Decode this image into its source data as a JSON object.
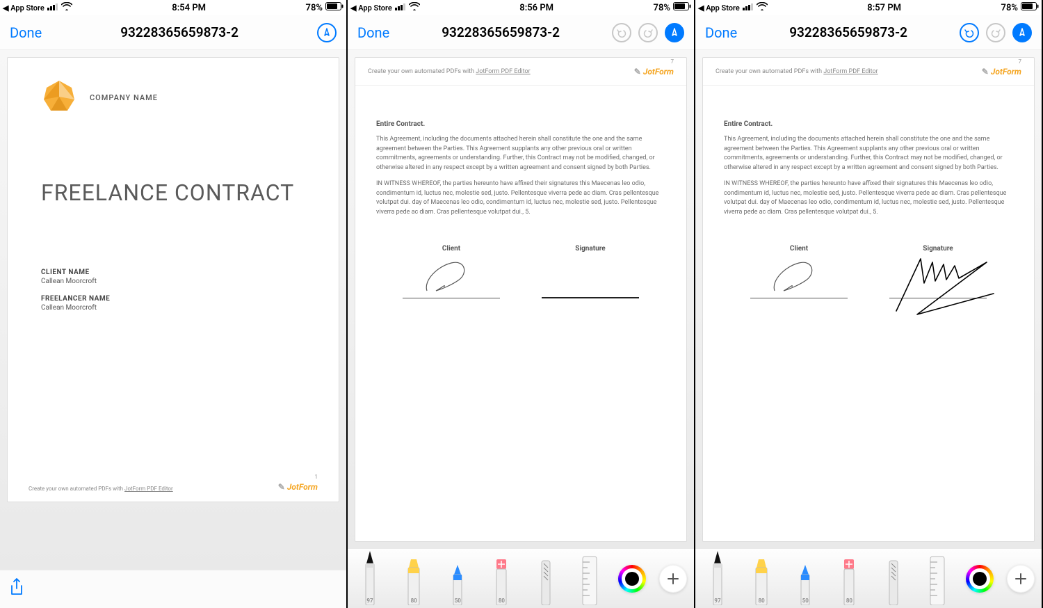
{
  "statusbar": {
    "back": "◀ App Store",
    "battery": "78%"
  },
  "screens": [
    {
      "time": "8:54 PM",
      "undoState": "none"
    },
    {
      "time": "8:56 PM",
      "undoState": "disabled"
    },
    {
      "time": "8:57 PM",
      "undoState": "enabled"
    }
  ],
  "nav": {
    "done": "Done",
    "title": "93228365659873-2"
  },
  "page1": {
    "company": "COMPANY NAME",
    "title": "FREELANCE CONTRACT",
    "clientLabel": "CLIENT NAME",
    "clientValue": "Callean Moorcroft",
    "freelancerLabel": "FREELANCER NAME",
    "freelancerValue": "Callean Moorcroft",
    "footerText": "Create your own automated PDFs with ",
    "footerLink": "JotForm PDF Editor",
    "brand": "JotForm",
    "pageNum": "1"
  },
  "page7": {
    "headerText": "Create your own automated PDFs with ",
    "headerLink": "JotForm PDF Editor",
    "brand": "JotForm",
    "pageNum": "7",
    "sectionTitle": "Entire Contract.",
    "para1": "This Agreement, including the documents attached herein shall constitute the one and the same agreement between the Parties. This Agreement supplants any other previous oral or written commitments, agreements or understanding. Further, this Contract may not be modified, changed, or otherwise altered in any respect except by a written agreement and consent signed by both Parties.",
    "para2": "IN WITNESS WHEREOF, the parties hereunto have affixed their signatures this Maecenas leo odio, condimentum id, luctus nec, molestie sed, justo. Pellentesque viverra pede ac diam. Cras pellentesque volutpat dui. day of Maecenas leo odio, condimentum id, luctus nec, molestie sed, justo. Pellentesque viverra pede ac diam. Cras pellentesque volutpat dui., 5.",
    "clientLabel": "Client",
    "signatureLabel": "Signature"
  },
  "tools": {
    "pen": "97",
    "highlighter": "80",
    "pencil": "50",
    "eraser": "80"
  }
}
